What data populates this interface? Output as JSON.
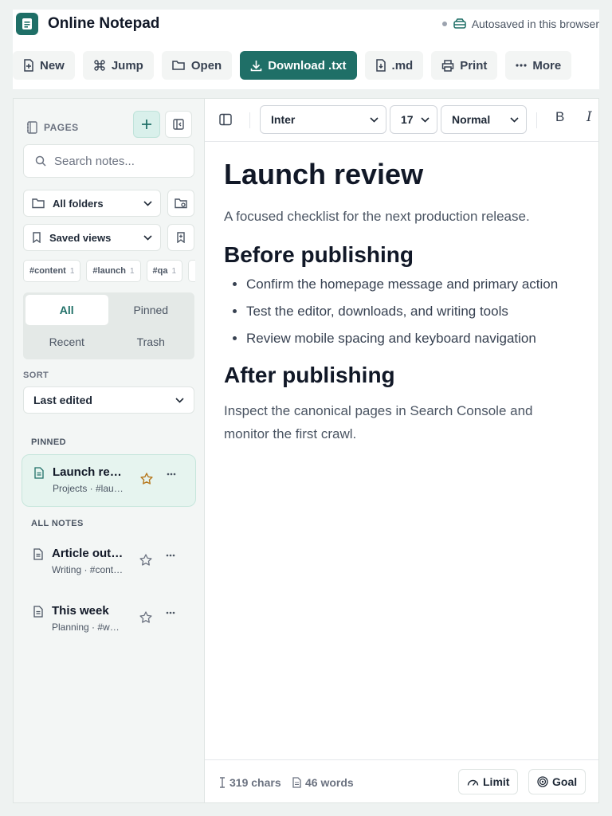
{
  "app": {
    "title": "Online Notepad",
    "autosave_text": "Autosaved in this browser",
    "accent": "#1f6f67"
  },
  "toolbar": {
    "new_label": "New",
    "jump_label": "Jump",
    "open_label": "Open",
    "download_txt_label": "Download .txt",
    "md_label": ".md",
    "print_label": "Print",
    "more_label": "More"
  },
  "sidebar": {
    "pages_label": "PAGES",
    "search_placeholder": "Search notes...",
    "folder_selected": "All folders",
    "views_selected": "Saved views",
    "tags": [
      {
        "name": "#content",
        "count": "1"
      },
      {
        "name": "#launch",
        "count": "1"
      },
      {
        "name": "#qa",
        "count": "1"
      }
    ],
    "filters": [
      "All",
      "Pinned",
      "Recent",
      "Trash"
    ],
    "active_filter": "All",
    "sort_label": "SORT",
    "sort_selected": "Last edited",
    "pinned_label": "PINNED",
    "all_notes_label": "ALL NOTES",
    "pinned_notes": [
      {
        "title": "Launch review",
        "meta": "Projects · #launch",
        "starred": true
      }
    ],
    "notes": [
      {
        "title": "Article outline",
        "meta": "Writing · #content",
        "starred": false
      },
      {
        "title": "This week",
        "meta": "Planning · #week",
        "starred": false
      }
    ]
  },
  "editor": {
    "font_family": "Inter",
    "font_size": "17",
    "block_style": "Normal",
    "bold_glyph": "B",
    "italic_glyph": "I",
    "doc": {
      "title": "Launch review",
      "subtitle": "A focused checklist for the next production release.",
      "section1": "Before publishing",
      "bullets": [
        "Confirm the homepage message and primary action",
        "Test the editor, downloads, and writing tools",
        "Review mobile spacing and keyboard navigation"
      ],
      "section2": "After publishing",
      "paragraph": "Inspect the canonical pages in Search Console and monitor the first crawl."
    },
    "status": {
      "chars": "319 chars",
      "words": "46 words",
      "limit_label": "Limit",
      "goal_label": "Goal"
    }
  }
}
